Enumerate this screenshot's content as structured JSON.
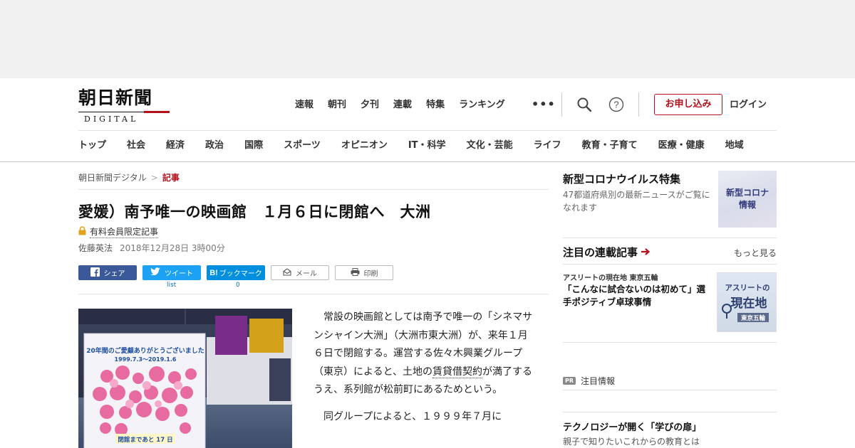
{
  "header": {
    "logo_title": "朝日新聞",
    "logo_sub": "DIGITAL",
    "top_nav": [
      "速報",
      "朝刊",
      "夕刊",
      "連載",
      "特集",
      "ランキング"
    ],
    "more_label": "•••",
    "subscribe_label": "お申し込み",
    "login_label": "ログイン",
    "categories": [
      "トップ",
      "社会",
      "経済",
      "政治",
      "国際",
      "スポーツ",
      "オピニオン",
      "IT・科学",
      "文化・芸能",
      "ライフ",
      "教育・子育て",
      "医療・健康",
      "地域"
    ],
    "accent_color": "#b3121d"
  },
  "article": {
    "breadcrumb": [
      "朝日新聞デジタル",
      "記事"
    ],
    "breadcrumb_sep": ">",
    "headline": "愛媛）南予唯一の映画館　１月６日に閉館へ　大洲",
    "premium_label": "有料会員限定記事",
    "author": "佐藤英法",
    "date": "2018年12月28日 3時00分",
    "share": {
      "facebook": "シェア",
      "twitter": "ツイート",
      "hatena": "ブックマーク",
      "mail": "メール",
      "print": "印刷",
      "twitter_count": "list",
      "hatena_count": "0"
    },
    "photo": {
      "sign_line1": "20年間のご愛顧ありがとうございました",
      "sign_line2": "1999.7.3～2019.1.6",
      "sign_line3": "閉館まであと 17 日"
    },
    "para1_a": "常設の映画館としては南予で唯一の「シネマサンシャイン大洲」（大洲市東大洲）が、来年１月６日で閉館する。運営する佐々木興業グループ（東京）によると、土地の",
    "para1_link": "賃貸借契約",
    "para1_b": "が満了するうえ、系列館が松前町にあるためという。",
    "para2": "同グループによると、１９９９年７月に"
  },
  "sidebar": {
    "corona_title": "新型コロナウイルス特集",
    "corona_desc": "47都道府県別の最新ニュースがご覧になれます",
    "corona_thumb_line1": "新型コロナ",
    "corona_thumb_line2": "情報",
    "series_title": "注目の連載記事",
    "series_more": "もっと見る",
    "series_kicker": "アスリートの現在地 東京五輪",
    "series_headline": "「こんなに試合ないのは初めて」選手ポジティブ卓球事情",
    "series_thumb_line1": "アスリートの",
    "series_thumb_line2": "現在地",
    "series_thumb_line3": "東京五輪",
    "pr_badge": "PR",
    "pr_label": "注目情報",
    "promo_title": "テクノロジーが開く「学びの扉」",
    "promo_sub": "親子で知りたいこれからの教育とは"
  }
}
